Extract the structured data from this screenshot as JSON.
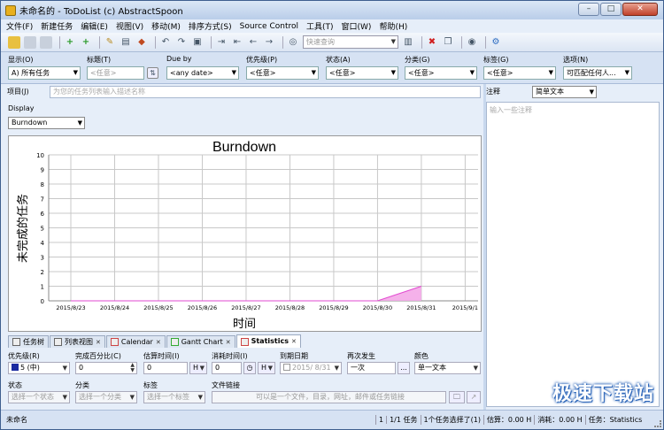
{
  "window": {
    "title": "未命名的 - ToDoList (c) AbstractSpoon",
    "buttons": [
      "–",
      "□",
      "✕"
    ]
  },
  "menu": [
    "文件(F)",
    "新建任务",
    "编辑(E)",
    "视图(V)",
    "移动(M)",
    "排序方式(S)",
    "Source Control",
    "工具(T)",
    "窗口(W)",
    "帮助(H)"
  ],
  "toolbar": {
    "search_placeholder": "快速查询"
  },
  "filters": [
    {
      "label": "显示(O)",
      "value": "A)  所有任务"
    },
    {
      "label": "标题(T)",
      "value": "<任意>"
    },
    {
      "label": "Due by",
      "value": "<any date>"
    },
    {
      "label": "优先级(P)",
      "value": "<任意>"
    },
    {
      "label": "状态(A)",
      "value": "<任意>"
    },
    {
      "label": "分类(G)",
      "value": "<任意>"
    },
    {
      "label": "标签(G)",
      "value": "<任意>"
    },
    {
      "label": "选项(N)",
      "value": "可匹配任何人..."
    }
  ],
  "project": {
    "label": "项目(J)",
    "placeholder": "为您的任务列表输入描述名称"
  },
  "display": {
    "label": "Display",
    "value": "Burndown"
  },
  "chart_data": {
    "type": "area",
    "title": "Burndown",
    "xlabel": "时间",
    "ylabel": "未完成的任务",
    "x": [
      "2015/8/23",
      "2015/8/24",
      "2015/8/25",
      "2015/8/26",
      "2015/8/27",
      "2015/8/28",
      "2015/8/29",
      "2015/8/30",
      "2015/8/31",
      "2015/9/1"
    ],
    "values": [
      0,
      0,
      0,
      0,
      0,
      0,
      0,
      0,
      1,
      1
    ],
    "yticks": [
      0,
      1,
      2,
      3,
      4,
      5,
      6,
      7,
      8,
      9,
      10
    ],
    "ylim": [
      0,
      10
    ],
    "grid": true,
    "fill_color": "#f4a9e8",
    "line_color": "#e24ad0"
  },
  "tabs": [
    {
      "label": "任务树",
      "active": false
    },
    {
      "label": "列表视图",
      "active": false
    },
    {
      "label": "Calendar",
      "active": false
    },
    {
      "label": "Gantt Chart",
      "active": false
    },
    {
      "label": "Statistics",
      "active": true
    }
  ],
  "attributes": {
    "priority": {
      "label": "优先级(R)",
      "value": "5 (中)"
    },
    "percent": {
      "label": "完成百分比(C)",
      "value": "0"
    },
    "estimate": {
      "label": "估算时间(I)",
      "value": "0",
      "unit": "H"
    },
    "spent": {
      "label": "消耗时间(I)",
      "value": "0",
      "unit": "H"
    },
    "due": {
      "label": "到期日期",
      "value": "2015/  8/31"
    },
    "recurrence": {
      "label": "再次发生",
      "value": "一次"
    },
    "color": {
      "label": "颜色",
      "value": "单一文本"
    },
    "status": {
      "label": "状态",
      "placeholder": "选择一个状态"
    },
    "category": {
      "label": "分类",
      "placeholder": "选择一个分类"
    },
    "tags": {
      "label": "标签",
      "placeholder": "选择一个标签"
    },
    "file_link": {
      "label": "文件链接",
      "placeholder": "可以是一个文件，目录，网址，邮件或任务链接"
    }
  },
  "comments": {
    "label": "注释",
    "type": "简单文本",
    "placeholder": "输入一些注释"
  },
  "watermark": "极速下载站",
  "status": {
    "filename": "未命名",
    "count": "1",
    "tasks": "1/1 任务",
    "selected": "1个任务选择了(1)",
    "estimate": "估算：0.00 H",
    "spent": "消耗：0.00 H",
    "view": "任务：Statistics"
  }
}
